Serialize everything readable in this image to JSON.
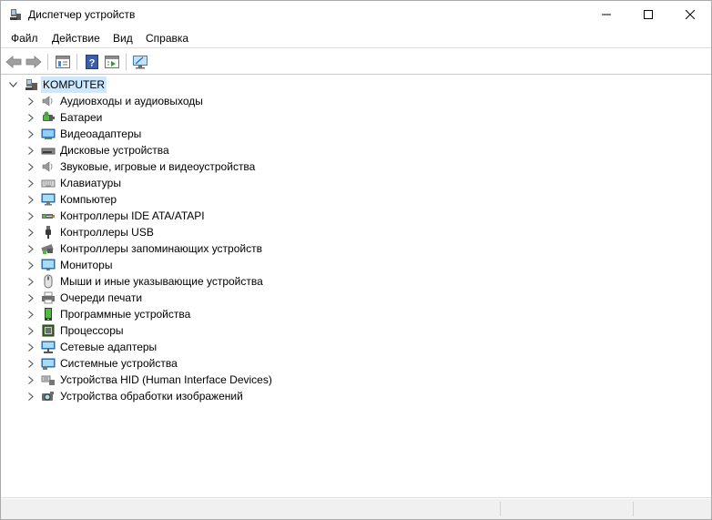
{
  "window": {
    "title": "Диспетчер устройств"
  },
  "menu": [
    {
      "label": "Файл"
    },
    {
      "label": "Действие"
    },
    {
      "label": "Вид"
    },
    {
      "label": "Справка"
    }
  ],
  "toolbar": [
    {
      "icon": "back-arrow-icon"
    },
    {
      "icon": "forward-arrow-icon"
    },
    {
      "icon": "properties-icon"
    },
    {
      "icon": "help-icon"
    },
    {
      "icon": "run-icon"
    },
    {
      "icon": "monitor-scan-icon"
    }
  ],
  "tree": {
    "root": "KOMPUTER",
    "items": [
      {
        "label": "Аудиовходы и аудиовыходы",
        "icon": "speaker-icon"
      },
      {
        "label": "Батареи",
        "icon": "battery-icon"
      },
      {
        "label": "Видеоадаптеры",
        "icon": "display-adapter-icon"
      },
      {
        "label": "Дисковые устройства",
        "icon": "disk-drive-icon"
      },
      {
        "label": "Звуковые, игровые и видеоустройства",
        "icon": "speaker-icon"
      },
      {
        "label": "Клавиатуры",
        "icon": "keyboard-icon"
      },
      {
        "label": "Компьютер",
        "icon": "computer-icon"
      },
      {
        "label": "Контроллеры IDE ATA/ATAPI",
        "icon": "ide-controller-icon"
      },
      {
        "label": "Контроллеры USB",
        "icon": "usb-icon"
      },
      {
        "label": "Контроллеры запоминающих устройств",
        "icon": "storage-controller-icon"
      },
      {
        "label": "Мониторы",
        "icon": "monitor-icon"
      },
      {
        "label": "Мыши и иные указывающие устройства",
        "icon": "mouse-icon"
      },
      {
        "label": "Очереди печати",
        "icon": "printer-icon"
      },
      {
        "label": "Программные устройства",
        "icon": "software-device-icon"
      },
      {
        "label": "Процессоры",
        "icon": "processor-icon"
      },
      {
        "label": "Сетевые адаптеры",
        "icon": "network-adapter-icon"
      },
      {
        "label": "Системные устройства",
        "icon": "system-device-icon"
      },
      {
        "label": "Устройства HID (Human Interface Devices)",
        "icon": "hid-icon"
      },
      {
        "label": "Устройства обработки изображений",
        "icon": "camera-icon"
      }
    ]
  }
}
